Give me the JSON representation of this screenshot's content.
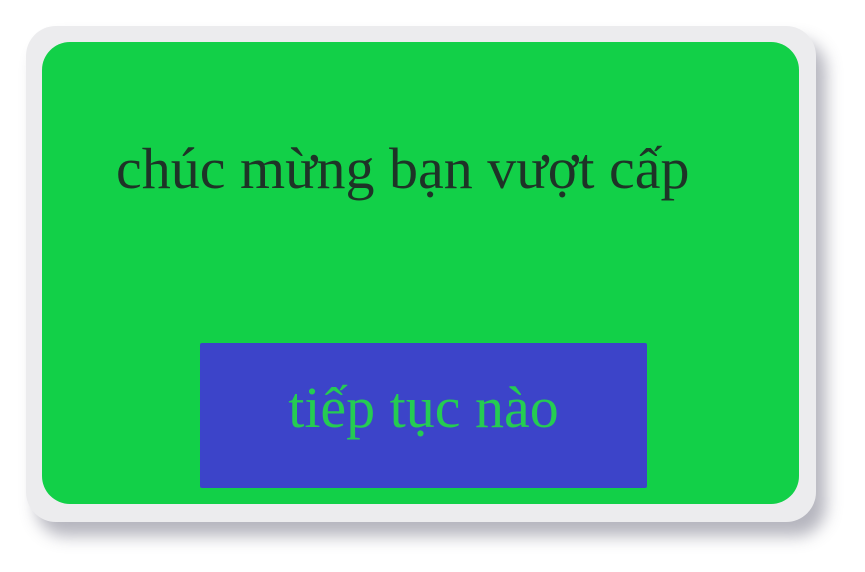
{
  "dialog": {
    "message": "chúc mừng bạn vượt cấp",
    "continue_label": "tiếp tục nào"
  },
  "colors": {
    "panel_background": "#12d048",
    "frame_background": "#ececee",
    "button_background": "#3c44c9",
    "button_text": "#25cc52",
    "message_text": "#1e3327"
  }
}
